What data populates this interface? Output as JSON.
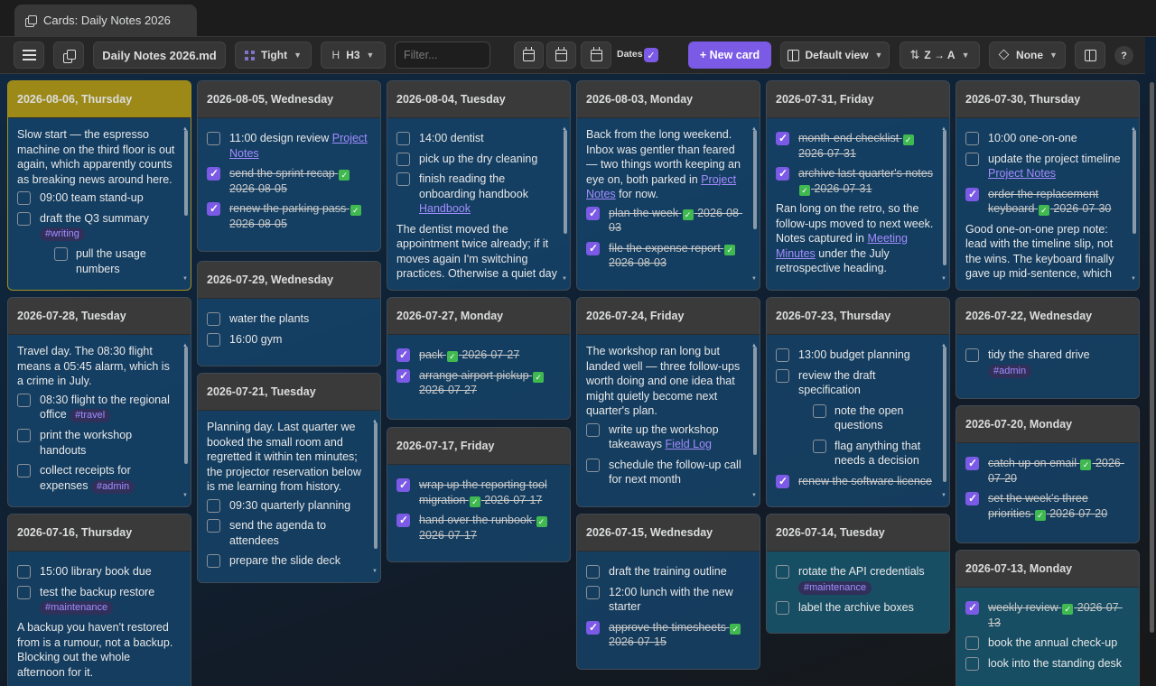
{
  "tab": {
    "title": "Cards: Daily Notes 2026"
  },
  "toolbar": {
    "file": "Daily Notes 2026.md",
    "density": "Tight",
    "heading": "H3",
    "filter_placeholder": "Filter...",
    "dates_label": "Dates",
    "new_card": "+ New card",
    "view": "Default view",
    "sort": "Z → A",
    "group": "None",
    "help": "?"
  },
  "colors": {
    "accent": "#7b5ae6",
    "active_header": "#9c8918",
    "card_bg": "#16466e",
    "tag": "#a38cff"
  },
  "cards": {
    "c0806": {
      "title": "2026-08-06, Thursday",
      "p1": "Slow start — the espresso machine on the third floor is out again, which apparently counts as breaking news around here.",
      "t1": "09:00 team stand-up",
      "t2": "draft the Q3 summary",
      "t2_tag": "#writing",
      "t3": "pull the usage numbers"
    },
    "c0805": {
      "title": "2026-08-05, Wednesday",
      "t1": "11:00 design review",
      "t1_link": "Project Notes",
      "t2": "send the sprint recap",
      "t2_date": "2026-08-05",
      "t3": "renew the parking pass",
      "t3_date": "2026-08-05"
    },
    "c0804": {
      "title": "2026-08-04, Tuesday",
      "t1": "14:00 dentist",
      "t2": "pick up the dry cleaning",
      "t3": "finish reading the onboarding handbook",
      "t3_link": "Handbook",
      "p1": "The dentist moved the appointment twice already; if it moves again I'm switching practices. Otherwise a quiet day"
    },
    "c0803": {
      "title": "2026-08-03, Monday",
      "p1": "Back from the long weekend. Inbox was gentler than feared — two things worth keeping an eye on, both parked in",
      "p1_link": "Project Notes",
      "p1_tail": "for now.",
      "t1": "plan the week",
      "t1_date": "2026-08-03",
      "t2": "file the expense report",
      "t2_date": "2026-08-03"
    },
    "c0731": {
      "title": "2026-07-31, Friday",
      "t1": "month-end checklist",
      "t1_date": "2026-07-31",
      "t2": "archive last quarter's notes",
      "t2_date": "2026-07-31",
      "p1": "Ran long on the retro, so the follow-ups moved to next week. Notes captured in",
      "p1_link": "Meeting Minutes",
      "p1_tail": "under the July retrospective heading."
    },
    "c0730": {
      "title": "2026-07-30, Thursday",
      "t1": "10:00 one-on-one",
      "t2": "update the project timeline",
      "t2_link": "Project Notes",
      "t3": "order the replacement keyboard",
      "t3_date": "2026-07-30",
      "p1": "Good one-on-one prep note: lead with the timeline slip, not the wins. The keyboard finally gave up mid-sentence, which"
    },
    "c0728": {
      "title": "2026-07-28, Tuesday",
      "p1": "Travel day. The 08:30 flight means a 05:45 alarm, which is a crime in July.",
      "t1": "08:30 flight to the regional office",
      "t1_tag": "#travel",
      "t2": "print the workshop handouts",
      "t3": "collect receipts for expenses",
      "t3_tag": "#admin"
    },
    "c0729": {
      "title": "2026-07-29, Wednesday",
      "t1": "water the plants",
      "t2": "16:00 gym"
    },
    "c0727": {
      "title": "2026-07-27, Monday",
      "t1": "pack",
      "t1_date": "2026-07-27",
      "t2": "arrange airport pickup",
      "t2_date": "2026-07-27"
    },
    "c0724": {
      "title": "2026-07-24, Friday",
      "p1": "The workshop ran long but landed well — three follow-ups worth doing and one idea that might quietly become next quarter's plan.",
      "t1": "write up the workshop takeaways",
      "t1_link": "Field Log",
      "t2": "schedule the follow-up call for next month"
    },
    "c0723": {
      "title": "2026-07-23, Thursday",
      "t1": "13:00 budget planning",
      "t2": "review the draft specification",
      "t3": "note the open questions",
      "t4": "flag anything that needs a decision",
      "t5": "renew the software licence"
    },
    "c0722": {
      "title": "2026-07-22, Wednesday",
      "t1": "tidy the shared drive",
      "t1_tag": "#admin"
    },
    "c0721": {
      "title": "2026-07-21, Tuesday",
      "p1": "Planning day. Last quarter we booked the small room and regretted it within ten minutes; the projector reservation below is me learning from history.",
      "t1": "09:30 quarterly planning",
      "t2": "send the agenda to attendees",
      "t3": "prepare the slide deck"
    },
    "c0717": {
      "title": "2026-07-17, Friday",
      "t1": "wrap up the reporting tool migration",
      "t1_date": "2026-07-17",
      "t2": "hand over the runbook",
      "t2_date": "2026-07-17"
    },
    "c0720": {
      "title": "2026-07-20, Monday",
      "t1": "catch up on email",
      "t1_date": "2026-07-20",
      "t2": "set the week's three priorities",
      "t2_date": "2026-07-20"
    },
    "c0716": {
      "title": "2026-07-16, Thursday",
      "t1": "15:00 library book due",
      "t2": "test the backup restore",
      "t2_tag": "#maintenance",
      "p1": "A backup you haven't restored from is a rumour, not a backup. Blocking out the whole afternoon for it."
    },
    "c0715": {
      "title": "2026-07-15, Wednesday",
      "t1": "draft the training outline",
      "t2": "12:00 lunch with the new starter",
      "t3": "approve the timesheets",
      "t3_date": "2026-07-15"
    },
    "c0714": {
      "title": "2026-07-14, Tuesday",
      "t1": "rotate the API credentials",
      "t1_tag": "#maintenance",
      "t2": "label the archive boxes"
    },
    "c0713": {
      "title": "2026-07-13, Monday",
      "t1": "weekly review",
      "t1_date": "2026-07-13",
      "t2": "book the annual check-up",
      "t3": "look into the standing desk"
    }
  }
}
